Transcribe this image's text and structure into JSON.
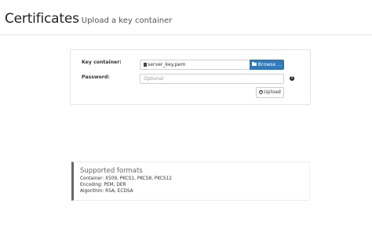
{
  "header": {
    "title": "Certificates",
    "subtitle": "Upload a key container"
  },
  "form": {
    "key_container_label": "Key container:",
    "file_name": "server_key.pem",
    "browse_label": "Browse ...",
    "password_label": "Password:",
    "password_value": "",
    "password_placeholder": "Optional",
    "help_glyph": "?",
    "upload_label": "Upload"
  },
  "info": {
    "title": "Supported formats",
    "lines": [
      "Container: X509, PKCS1, PKCS8, PKCS12",
      "Encoding: PEM, DER",
      "Algorithm: RSA, ECDSA"
    ]
  },
  "colors": {
    "primary": "#337ab7",
    "callout_border": "#666666"
  },
  "icons": {
    "file": "file-icon",
    "browse": "folder-open-icon",
    "help": "question-circle-icon",
    "upload": "upload-icon"
  }
}
